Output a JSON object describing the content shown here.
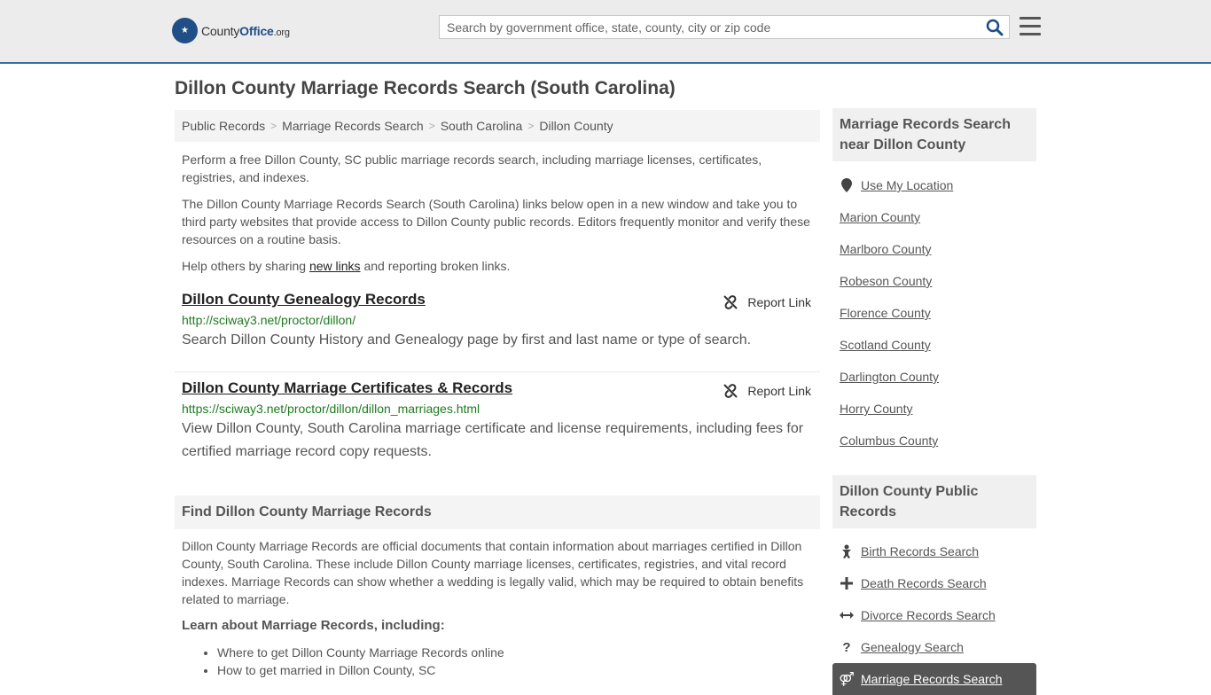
{
  "header": {
    "logo_text_prefix": "County",
    "logo_text_brand": "Office",
    "logo_text_suffix": ".org",
    "search_placeholder": "Search by government office, state, county, city or zip code"
  },
  "page_title": "Dillon County Marriage Records Search (South Carolina)",
  "breadcrumb": [
    "Public Records",
    "Marriage Records Search",
    "South Carolina",
    "Dillon County"
  ],
  "intro": {
    "p1": "Perform a free Dillon County, SC public marriage records search, including marriage licenses, certificates, registries, and indexes.",
    "p2": "The Dillon County Marriage Records Search (South Carolina) links below open in a new window and take you to third party websites that provide access to Dillon County public records. Editors frequently monitor and verify these resources on a routine basis.",
    "p3_before": "Help others by sharing ",
    "p3_link": "new links",
    "p3_after": " and reporting broken links."
  },
  "results": [
    {
      "title": "Dillon County Genealogy Records",
      "url": "http://sciway3.net/proctor/dillon/",
      "description": "Search Dillon County History and Genealogy page by first and last name or type of search.",
      "report_label": "Report Link"
    },
    {
      "title": "Dillon County Marriage Certificates & Records",
      "url": "https://sciway3.net/proctor/dillon/dillon_marriages.html",
      "description": "View Dillon County, South Carolina marriage certificate and license requirements, including fees for certified marriage record copy requests.",
      "report_label": "Report Link"
    }
  ],
  "find_section": {
    "heading": "Find Dillon County Marriage Records",
    "paragraph": "Dillon County Marriage Records are official documents that contain information about marriages certified in Dillon County, South Carolina. These include Dillon County marriage licenses, certificates, registries, and vital record indexes. Marriage Records can show whether a wedding is legally valid, which may be required to obtain benefits related to marriage.",
    "learn_heading": "Learn about Marriage Records, including:",
    "learn_items": [
      "Where to get Dillon County Marriage Records online",
      "How to get married in Dillon County, SC"
    ]
  },
  "sidebar_nearby": {
    "heading": "Marriage Records Search near Dillon County",
    "use_location": "Use My Location",
    "items": [
      "Marion County",
      "Marlboro County",
      "Robeson County",
      "Florence County",
      "Scotland County",
      "Darlington County",
      "Horry County",
      "Columbus County"
    ]
  },
  "sidebar_public": {
    "heading": "Dillon County Public Records",
    "items": [
      {
        "label": "Birth Records Search",
        "icon": "baby-icon"
      },
      {
        "label": "Death Records Search",
        "icon": "cross-icon"
      },
      {
        "label": "Divorce Records Search",
        "icon": "split-arrows-icon"
      },
      {
        "label": "Genealogy Search",
        "icon": "question-icon"
      },
      {
        "label": "Marriage Records Search",
        "icon": "marriage-symbol-icon"
      }
    ]
  }
}
